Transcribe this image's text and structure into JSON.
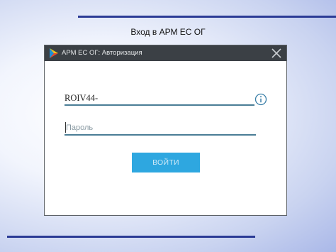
{
  "slide": {
    "title": "Вход в АРМ ЕС ОГ"
  },
  "window": {
    "title": "АРМ ЕС ОГ: Авторизация",
    "app_icon": "play-triangle-icon",
    "close_icon": "close-icon"
  },
  "login_form": {
    "login_value": "ROIV44-",
    "info_icon": "info-icon",
    "password_placeholder": "Пароль",
    "submit_label": "ВОЙТИ"
  },
  "colors": {
    "rule": "#2b3b95",
    "titlebar": "#3b4045",
    "field_underline": "#4a7d96",
    "button": "#2ea7e0"
  }
}
